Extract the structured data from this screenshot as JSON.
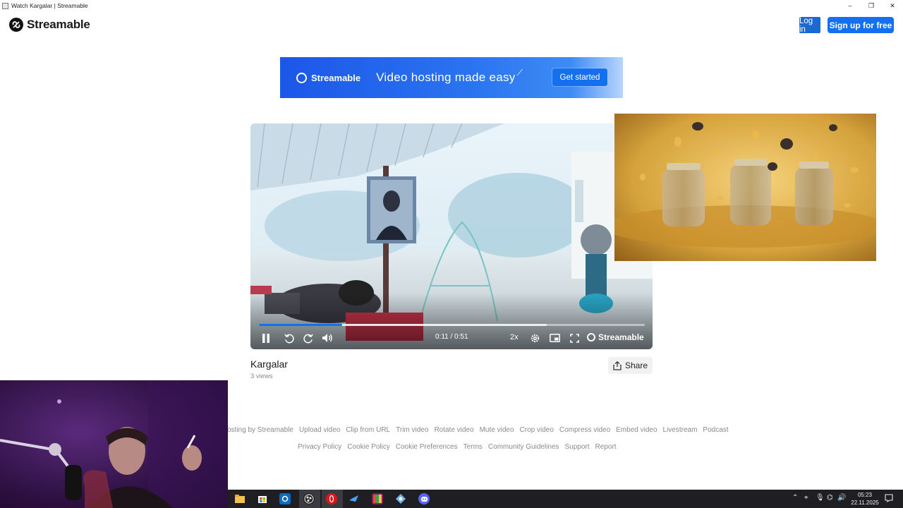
{
  "window": {
    "title": "Watch Kargalar | Streamable",
    "minimize_glyph": "–",
    "restore_glyph": "❐",
    "close_glyph": "✕"
  },
  "header": {
    "brand": "Streamable",
    "login_label": "Log in",
    "signup_label": "Sign up for free"
  },
  "banner": {
    "brand": "Streamable",
    "tagline": "Video hosting made easy",
    "cta_label": "Get started"
  },
  "player": {
    "time": "0:11 / 0:51",
    "speed": "2x",
    "brand": "Streamable",
    "played_fraction": 0.2157,
    "buffered_fraction": 0.746
  },
  "video": {
    "title": "Kargalar",
    "views": "3 views",
    "share_label": "Share"
  },
  "footer": {
    "row1": [
      "osting by Streamable",
      "Upload video",
      "Clip from URL",
      "Trim video",
      "Rotate video",
      "Mute video",
      "Crop video",
      "Compress video",
      "Embed video",
      "Livestream",
      "Podcast"
    ],
    "row2": [
      "Privacy Policy",
      "Cookie Policy",
      "Cookie Preferences",
      "Terms",
      "Community Guidelines",
      "Support",
      "Report"
    ]
  },
  "taskbar": {
    "apps": [
      "file-explorer-icon",
      "store-icon",
      "outlook-icon",
      "obs-icon",
      "opera-icon",
      "steam-icon",
      "winrar-icon",
      "network-tool-icon",
      "discord-icon"
    ],
    "tray_icons": [
      "chevron-up-icon",
      "usb-icon",
      "microphone-icon",
      "network-icon",
      "volume-icon"
    ],
    "time": "05:23",
    "date": "22.11.2025"
  },
  "colors": {
    "accent": "#1570ef",
    "taskbar": "#1f1f23"
  }
}
